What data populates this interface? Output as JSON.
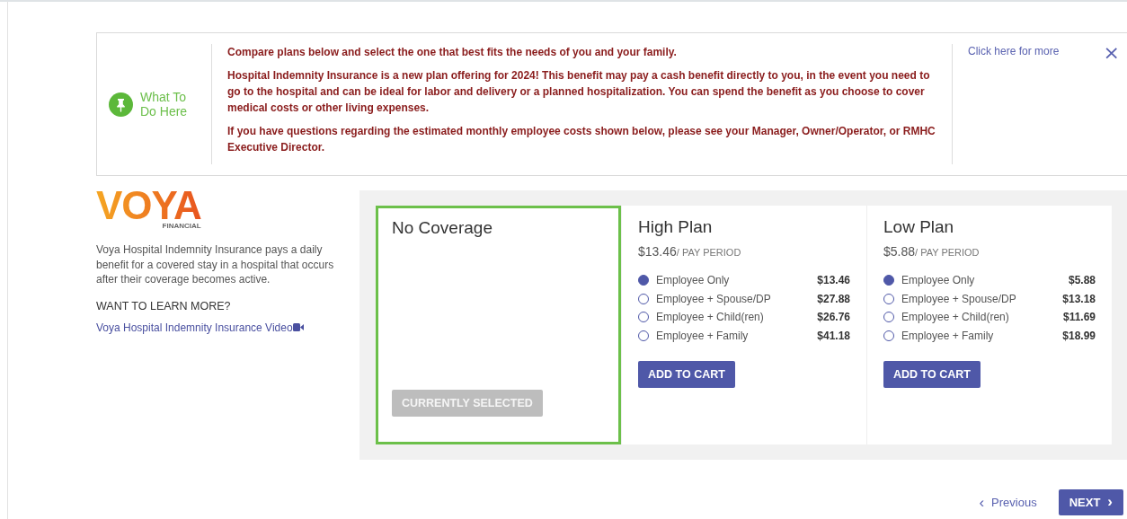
{
  "banner": {
    "heading": "What To Do Here",
    "paragraphs": [
      "Compare plans below and select the one that best fits the needs of you and your family.",
      "Hospital Indemnity Insurance is a new plan offering for 2024! This benefit may pay a cash benefit directly to you, in the event you need to go to the hospital and can be ideal for labor and delivery or a planned hospitalization. You can spend the benefit as you choose to cover medical costs or other living expenses.",
      "If you have questions regarding the estimated monthly employee costs shown below, please see your Manager, Owner/Operator, or RMHC Executive Director."
    ],
    "more_link": "Click here for more",
    "close": "×"
  },
  "provider": {
    "logo": "VOYA",
    "logo_sub": "FINANCIAL",
    "description": "Voya Hospital Indemnity Insurance pays a daily benefit for a covered stay in a hospital that occurs after their coverage becomes active.",
    "learn_more": "WANT TO LEARN MORE?",
    "video_link": "Voya Hospital Indemnity Insurance Video"
  },
  "plans": [
    {
      "kind": "none",
      "name": "No Coverage",
      "selected": true,
      "button": {
        "label": "CURRENTLY SELECTED",
        "disabled": true
      }
    },
    {
      "kind": "plan",
      "name": "High Plan",
      "selected": false,
      "price": "$13.46",
      "period": "/ PAY PERIOD",
      "options": [
        {
          "label": "Employee Only",
          "cost": "$13.46",
          "selected": true
        },
        {
          "label": "Employee + Spouse/DP",
          "cost": "$27.88",
          "selected": false
        },
        {
          "label": "Employee + Child(ren)",
          "cost": "$26.76",
          "selected": false
        },
        {
          "label": "Employee + Family",
          "cost": "$41.18",
          "selected": false
        }
      ],
      "button": {
        "label": "ADD TO CART",
        "disabled": false
      }
    },
    {
      "kind": "plan",
      "name": "Low Plan",
      "selected": false,
      "price": "$5.88",
      "period": "/ PAY PERIOD",
      "options": [
        {
          "label": "Employee Only",
          "cost": "$5.88",
          "selected": true
        },
        {
          "label": "Employee + Spouse/DP",
          "cost": "$13.18",
          "selected": false
        },
        {
          "label": "Employee + Child(ren)",
          "cost": "$11.69",
          "selected": false
        },
        {
          "label": "Employee + Family",
          "cost": "$18.99",
          "selected": false
        }
      ],
      "button": {
        "label": "ADD TO CART",
        "disabled": false
      }
    }
  ],
  "navigation": {
    "previous": {
      "arrow": "‹",
      "label": "Previous"
    },
    "next": {
      "label": "NEXT",
      "arrow": "›"
    }
  }
}
